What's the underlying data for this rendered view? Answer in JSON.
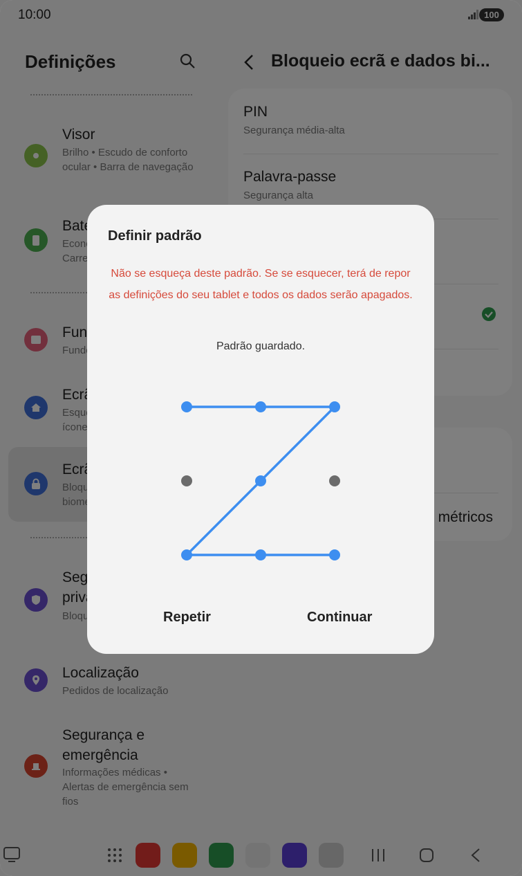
{
  "status": {
    "time": "10:00",
    "battery": "100"
  },
  "left": {
    "title": "Definições",
    "items": [
      {
        "title": "Visor",
        "subtitle": "Brilho • Escudo de conforto ocular • Barra de navegação",
        "icon": "sun-icon",
        "color": "#8bc34a"
      },
      {
        "title": "Bateria",
        "subtitle": "Economia de energia • Carregamento",
        "icon": "battery-icon",
        "color": "#4caf50"
      },
      {
        "title": "Fundo",
        "subtitle": "Fundo",
        "icon": "image-icon",
        "color": "#e5607a"
      },
      {
        "title": "Ecrã principal",
        "subtitle": "Esquema • Emblemas de ícones",
        "icon": "home-icon",
        "color": "#3f6fd8"
      },
      {
        "title": "Ecrã de bloqueio",
        "subtitle": "Bloqueio do ecrã • Dados biométricos",
        "icon": "lock-icon",
        "color": "#3f6fd8"
      },
      {
        "title": "Segurança e privacidade",
        "subtitle": "Bloqueio • Utilização",
        "icon": "shield-icon",
        "color": "#6a4fd0"
      },
      {
        "title": "Localização",
        "subtitle": "Pedidos de localização",
        "icon": "location-icon",
        "color": "#6a4fd0"
      },
      {
        "title": "Segurança e emergência",
        "subtitle": "Informações médicas • Alertas de emergência sem fios",
        "icon": "emergency-icon",
        "color": "#d9452f"
      }
    ]
  },
  "right": {
    "title": "Bloqueio ecrã e dados bi...",
    "rows": [
      {
        "title": "PIN",
        "subtitle": "Segurança média-alta"
      },
      {
        "title": "Palavra-passe",
        "subtitle": "Segurança alta"
      }
    ],
    "partial_text": "métricos"
  },
  "dialog": {
    "title": "Definir padrão",
    "warning": "Não se esqueça deste padrão. Se se esquecer, terá de repor as definições do seu tablet e todos os dados serão apagados.",
    "status": "Padrão guardado.",
    "pattern_sequence": [
      1,
      2,
      3,
      5,
      7,
      8,
      9
    ],
    "active_color": "#3d8ef0",
    "inactive_color": "#6b6b6b",
    "repeat_label": "Repetir",
    "continue_label": "Continuar"
  }
}
